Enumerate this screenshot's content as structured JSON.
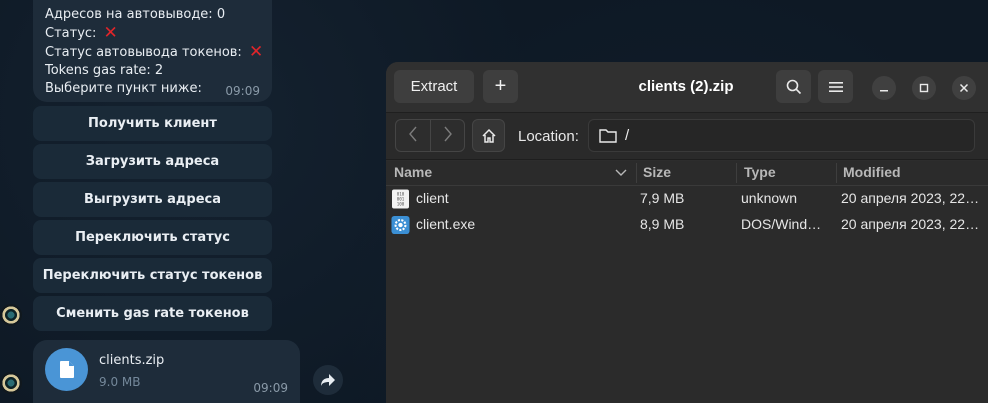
{
  "chat": {
    "message_lines": [
      "Адресов на автовыводе: 0",
      "Статус: ",
      "Статус автовывода токенов: ",
      "Tokens gas rate: 2",
      "Выберите пункт ниже:"
    ],
    "message_time": "09:09",
    "keyboard": [
      "Получить клиент",
      "Загрузить адреса",
      "Выгрузить адреса",
      "Переключить статус",
      "Переключить статус токенов",
      "Сменить gas rate токенов"
    ],
    "file": {
      "name": "clients.zip",
      "size": "9.0 MB",
      "time": "09:09"
    }
  },
  "archive": {
    "extract_label": "Extract",
    "add_label": "+",
    "title": "clients (2).zip",
    "location_label": "Location:",
    "location_path": "/",
    "columns": [
      "Name",
      "Size",
      "Type",
      "Modified"
    ],
    "rows": [
      {
        "name": "client",
        "size": "7,9 MB",
        "type": "unknown",
        "modified": "20 апреля 2023, 22…",
        "icon": "binary-file-icon"
      },
      {
        "name": "client.exe",
        "size": "8,9 MB",
        "type": "DOS/Wind…",
        "modified": "20 апреля 2023, 22…",
        "icon": "exe-gear-icon"
      }
    ]
  },
  "colors": {
    "status_off": "#e0252a",
    "file_icon_blue": "#4a95d6"
  }
}
